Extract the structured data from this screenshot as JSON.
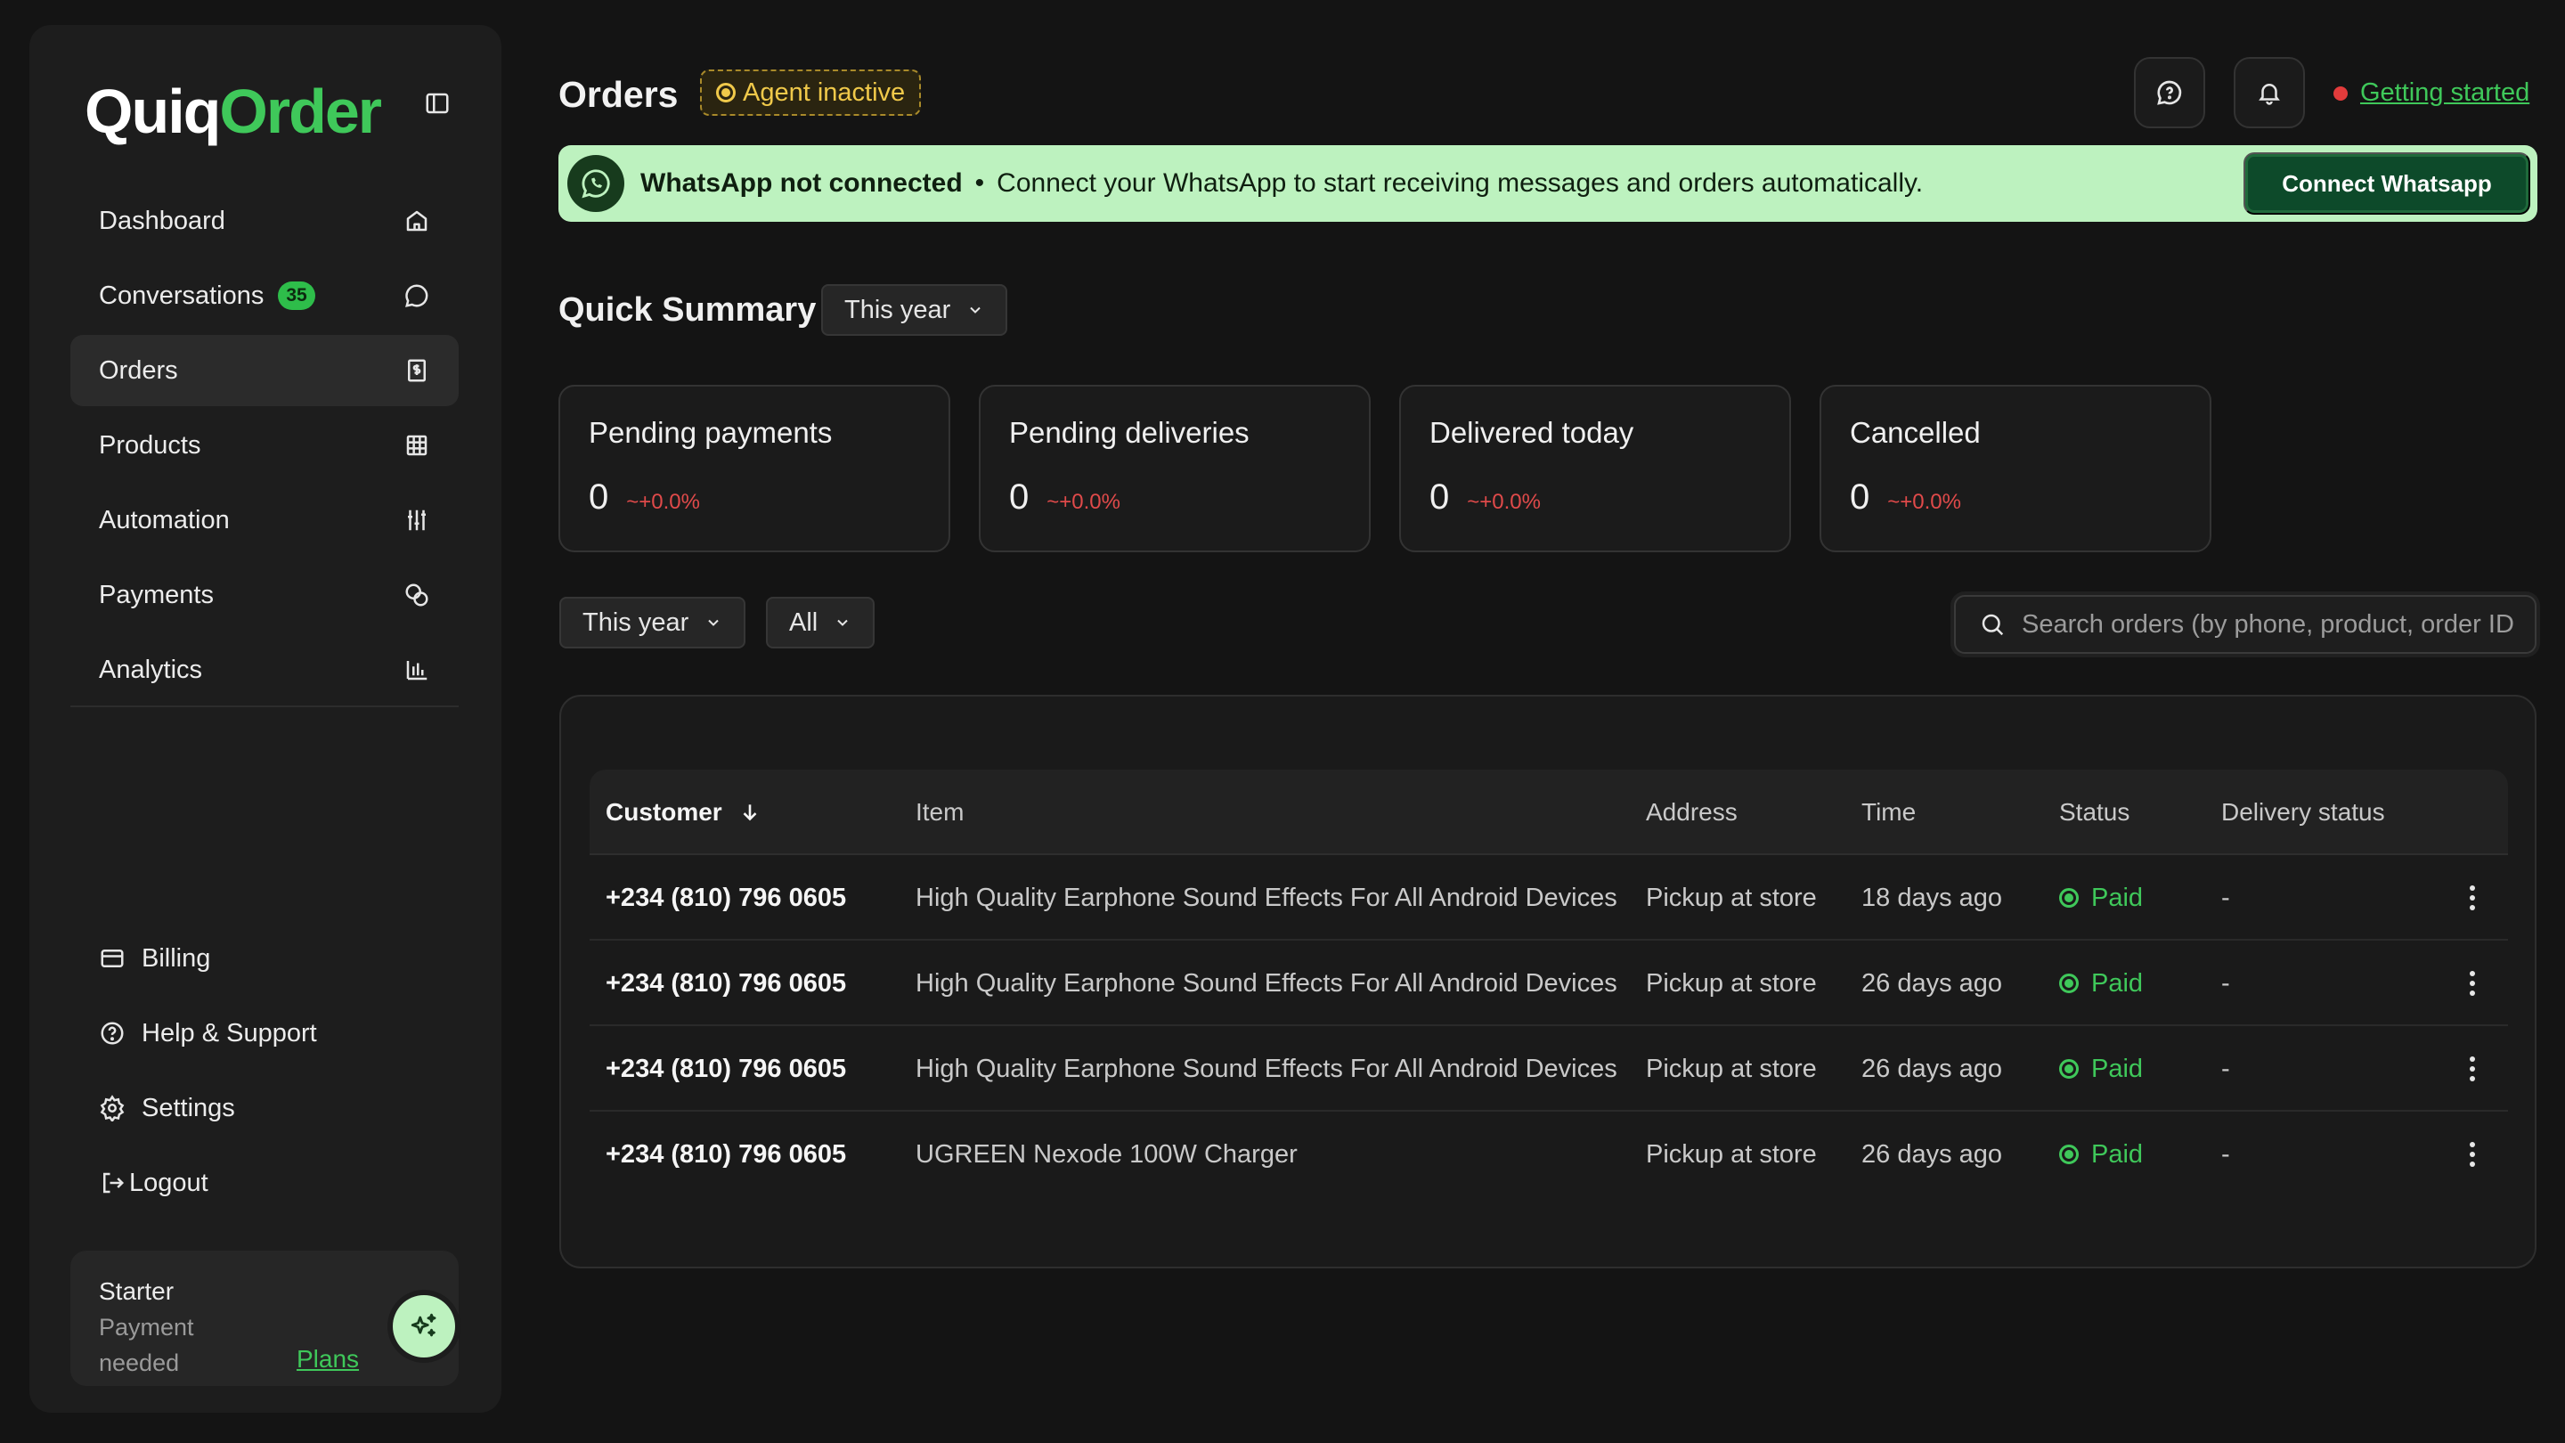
{
  "app": {
    "logo_part1": "Quiq",
    "logo_part2": "Order"
  },
  "sidebar": {
    "items": [
      {
        "label": "Dashboard",
        "icon": "home-icon"
      },
      {
        "label": "Conversations",
        "badge": "35",
        "icon": "chat-icon"
      },
      {
        "label": "Orders",
        "icon": "receipt-icon",
        "active": true
      },
      {
        "label": "Products",
        "icon": "grid-icon"
      },
      {
        "label": "Automation",
        "icon": "sliders-icon"
      },
      {
        "label": "Payments",
        "icon": "coins-icon"
      },
      {
        "label": "Analytics",
        "icon": "bar-chart-icon"
      }
    ],
    "bottom": [
      {
        "label": "Billing",
        "icon": "card-icon"
      },
      {
        "label": "Help & Support",
        "icon": "help-icon"
      },
      {
        "label": "Settings",
        "icon": "gear-icon"
      },
      {
        "label": "Logout",
        "icon": "logout-icon"
      }
    ],
    "plan": {
      "name": "Starter",
      "status": "Payment needed",
      "link": "Plans"
    }
  },
  "header": {
    "title": "Orders",
    "agent_status": "Agent inactive",
    "getting_started": "Getting started"
  },
  "banner": {
    "title": "WhatsApp not connected",
    "separator": "•",
    "message": "Connect your WhatsApp to start receiving messages and orders automatically.",
    "button": "Connect Whatsapp"
  },
  "summary": {
    "title": "Quick Summary",
    "range": "This year",
    "cards": [
      {
        "label": "Pending payments",
        "value": "0",
        "change": "~+0.0%"
      },
      {
        "label": "Pending deliveries",
        "value": "0",
        "change": "~+0.0%"
      },
      {
        "label": "Delivered today",
        "value": "0",
        "change": "~+0.0%"
      },
      {
        "label": "Cancelled",
        "value": "0",
        "change": "~+0.0%"
      }
    ]
  },
  "filters": {
    "range": "This year",
    "status": "All",
    "search_placeholder": "Search orders (by phone, product, order ID"
  },
  "table": {
    "columns": [
      "Customer",
      "Item",
      "Address",
      "Time",
      "Status",
      "Delivery status"
    ],
    "rows": [
      {
        "customer": "+234 (810) 796 0605",
        "item": "High Quality Earphone Sound Effects For All Android Devices",
        "address": "Pickup at store",
        "time": "18 days ago",
        "status": "Paid",
        "delivery": "-"
      },
      {
        "customer": "+234 (810) 796 0605",
        "item": "High Quality Earphone Sound Effects For All Android Devices",
        "address": "Pickup at store",
        "time": "26 days ago",
        "status": "Paid",
        "delivery": "-"
      },
      {
        "customer": "+234 (810) 796 0605",
        "item": "High Quality Earphone Sound Effects For All Android Devices",
        "address": "Pickup at store",
        "time": "26 days ago",
        "status": "Paid",
        "delivery": "-"
      },
      {
        "customer": "+234 (810) 796 0605",
        "item": "UGREEN Nexode 100W Charger",
        "address": "Pickup at store",
        "time": "26 days ago",
        "status": "Paid",
        "delivery": "-"
      }
    ]
  },
  "colors": {
    "accent": "#3fc85a",
    "banner_bg": "#bdf2bf",
    "warning": "#f0c94a",
    "negative": "#e04a4a"
  }
}
